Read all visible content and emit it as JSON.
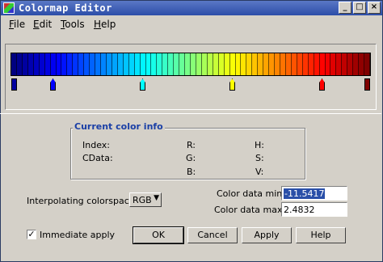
{
  "window": {
    "title": "Colormap Editor"
  },
  "titlebar_buttons": {
    "minimize": "_",
    "maximize": "□",
    "close": "×"
  },
  "menu": [
    {
      "label": "File",
      "accel": "F",
      "rest": "ile"
    },
    {
      "label": "Edit",
      "accel": "E",
      "rest": "dit"
    },
    {
      "label": "Tools",
      "accel": "T",
      "rest": "ools"
    },
    {
      "label": "Help",
      "accel": "H",
      "rest": "elp"
    }
  ],
  "colormap": {
    "name": "jet",
    "cell_count": 64,
    "nodes": [
      {
        "color": "#0000a0",
        "kind": "end"
      },
      {
        "color": "#0000ff",
        "kind": "node"
      },
      {
        "color": "#00ffff",
        "kind": "node"
      },
      {
        "color": "#ffff00",
        "kind": "node"
      },
      {
        "color": "#ff0000",
        "kind": "node"
      },
      {
        "color": "#800000",
        "kind": "end"
      }
    ]
  },
  "info": {
    "title": "Current color info",
    "index_label": "Index:",
    "cdata_label": "CData:",
    "r_label": "R:",
    "g_label": "G:",
    "b_label": "B:",
    "h_label": "H:",
    "s_label": "S:",
    "v_label": "V:"
  },
  "interp": {
    "label": "Interpolating colorspace:",
    "value": "RGB",
    "arrow": "▼"
  },
  "cdata_min": {
    "label": "Color data min:",
    "value": "-11.5417"
  },
  "cdata_max": {
    "label": "Color data max:",
    "value": "2.4832"
  },
  "immediate": {
    "label": "Immediate apply",
    "checked": "✓"
  },
  "buttons": {
    "ok": "OK",
    "cancel": "Cancel",
    "apply": "Apply",
    "help": "Help"
  }
}
